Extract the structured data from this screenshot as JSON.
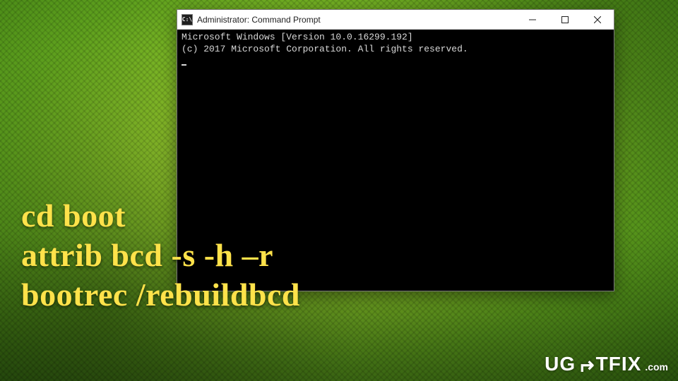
{
  "window": {
    "icon_label": "C:\\",
    "title": "Administrator: Command Prompt",
    "controls": {
      "minimize": "Minimize",
      "maximize": "Maximize",
      "close": "Close"
    }
  },
  "terminal": {
    "line1": "Microsoft Windows [Version 10.0.16299.192]",
    "line2": "(c) 2017 Microsoft Corporation. All rights reserved."
  },
  "overlay": {
    "cmd1": "cd boot",
    "cmd2": "attrib bcd -s -h –r",
    "cmd3": "bootrec /rebuildbcd"
  },
  "watermark": {
    "part1": "UG",
    "arrow": "↵",
    "part2": "TFIX",
    "tld": ".com"
  }
}
